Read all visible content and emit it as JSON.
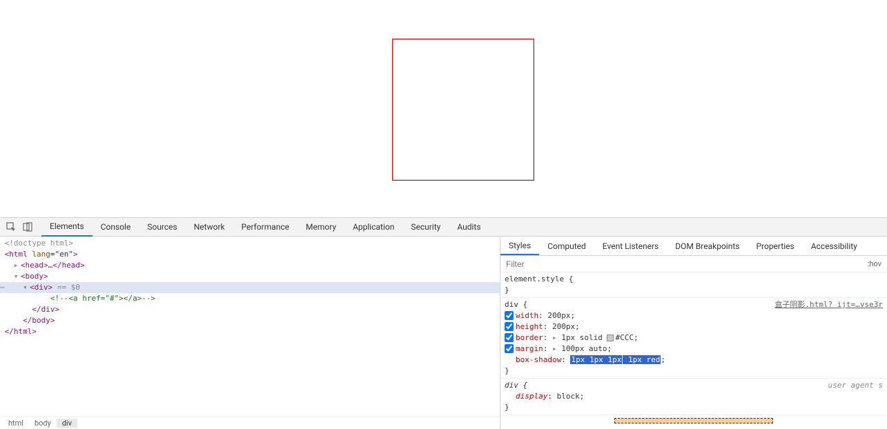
{
  "devtools_tabs": {
    "elements": "Elements",
    "console": "Console",
    "sources": "Sources",
    "network": "Network",
    "performance": "Performance",
    "memory": "Memory",
    "application": "Application",
    "security": "Security",
    "audits": "Audits"
  },
  "dom": {
    "doctype": "<!doctype html>",
    "html_open": "<html lang=\"en\">",
    "head": "<head>…</head>",
    "body_open": "<body>",
    "div_open": "<div>",
    "sel_hint": " == $0",
    "comment": "<!--<a href=\"#\"></a>-->",
    "div_close": "</div>",
    "body_close": "</body>",
    "html_close": "</html>"
  },
  "breadcrumbs": {
    "b0": "html",
    "b1": "body",
    "b2": "div"
  },
  "styles_tabs": {
    "styles": "Styles",
    "computed": "Computed",
    "listeners": "Event Listeners",
    "dom_bp": "DOM Breakpoints",
    "properties": "Properties",
    "accessibility": "Accessibility"
  },
  "filter": {
    "placeholder": "Filter",
    "hov": ":hov"
  },
  "rules": {
    "element_style": {
      "selector": "element.style {",
      "close": "}"
    },
    "div_rule": {
      "selector": "div {",
      "source": "盒子阴影.html? ijt=…vse3r",
      "p_width_name": "width",
      "p_width_val": "200px",
      "p_height_name": "height",
      "p_height_val": "200px",
      "p_border_name": "border",
      "p_border_val_pre": "1px solid ",
      "p_border_val_color": "#CCC",
      "p_margin_name": "margin",
      "p_margin_val": "100px auto",
      "p_bs_name": "box-shadow",
      "p_bs_val_sel": "1px 1px 1px",
      "p_bs_val_rest": " 1px red",
      "close": "}"
    },
    "ua_rule": {
      "selector": "div {",
      "label": "user agent s",
      "p_display_name": "display",
      "p_display_val": "block",
      "close": "}"
    }
  }
}
